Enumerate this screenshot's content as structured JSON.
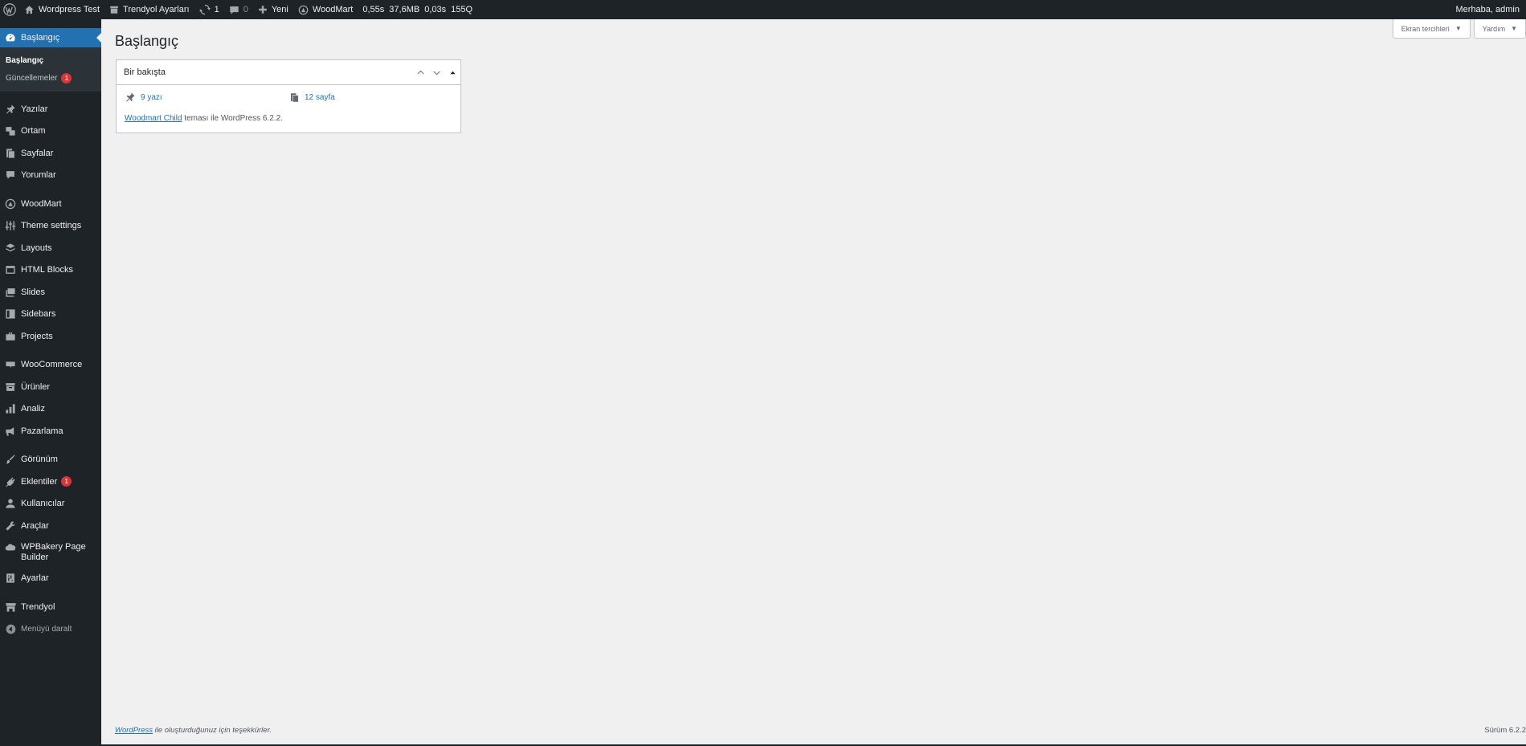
{
  "adminbar": {
    "site_name": "Wordpress Test",
    "trendyol_settings": "Trendyol Ayarları",
    "updates_count": "1",
    "comments_count": "0",
    "new_label": "Yeni",
    "woodmart_label": "WoodMart",
    "stat_time": "0,55s",
    "stat_memory": "37,6MB",
    "stat_query_time": "0,03s",
    "stat_queries": "155Q",
    "greeting": "Merhaba, admin"
  },
  "sidebar": {
    "current": "Başlangıç",
    "submenu": [
      {
        "label": "Başlangıç"
      },
      {
        "label": "Güncellemeler",
        "badge": "1"
      }
    ],
    "group1": [
      {
        "label": "Yazılar",
        "icon": "pin-icon"
      },
      {
        "label": "Ortam",
        "icon": "media-icon"
      },
      {
        "label": "Sayfalar",
        "icon": "pages-icon"
      },
      {
        "label": "Yorumlar",
        "icon": "comments-icon"
      }
    ],
    "group2": [
      {
        "label": "WoodMart",
        "icon": "woodmart-icon"
      },
      {
        "label": "Theme settings",
        "icon": "sliders-icon"
      },
      {
        "label": "Layouts",
        "icon": "layers-icon"
      },
      {
        "label": "HTML Blocks",
        "icon": "html-icon"
      },
      {
        "label": "Slides",
        "icon": "slides-icon"
      },
      {
        "label": "Sidebars",
        "icon": "sidebar-icon"
      },
      {
        "label": "Projects",
        "icon": "briefcase-icon"
      }
    ],
    "group3": [
      {
        "label": "WooCommerce",
        "icon": "woo-icon"
      },
      {
        "label": "Ürünler",
        "icon": "archive-icon"
      },
      {
        "label": "Analiz",
        "icon": "chart-icon"
      },
      {
        "label": "Pazarlama",
        "icon": "megaphone-icon"
      }
    ],
    "group4": [
      {
        "label": "Görünüm",
        "icon": "brush-icon"
      },
      {
        "label": "Eklentiler",
        "icon": "plugin-icon",
        "badge": "1"
      },
      {
        "label": "Kullanıcılar",
        "icon": "user-icon"
      },
      {
        "label": "Araçlar",
        "icon": "wrench-icon"
      },
      {
        "label": "WPBakery Page Builder",
        "icon": "cloud-icon"
      },
      {
        "label": "Ayarlar",
        "icon": "settings-icon"
      }
    ],
    "group5": [
      {
        "label": "Trendyol",
        "icon": "store-icon"
      }
    ],
    "collapse_label": "Menüyü daralt"
  },
  "main": {
    "screen_options": "Ekran tercihleri",
    "help": "Yardım",
    "page_title": "Başlangıç",
    "glance": {
      "title": "Bir bakışta",
      "posts": "9 yazı",
      "pages": "12 sayfa",
      "theme_link": "Woodmart Child",
      "theme_text": " teması ile WordPress 6.2.2."
    },
    "footer_link": "WordPress",
    "footer_text": " ile oluşturduğunuz için teşekkürler.",
    "version": "Sürüm 6.2.2"
  }
}
